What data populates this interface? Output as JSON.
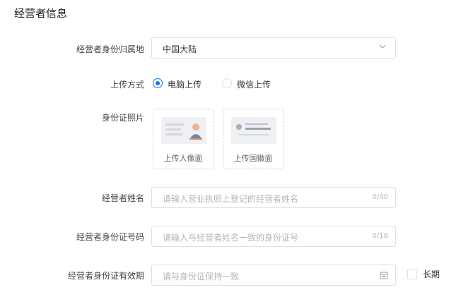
{
  "section": {
    "title": "经营者信息"
  },
  "identity_region": {
    "label": "经营者身份归属地",
    "value": "中国大陆"
  },
  "upload_method": {
    "label": "上传方式",
    "options": [
      {
        "label": "电脑上传",
        "checked": true
      },
      {
        "label": "微信上传",
        "checked": false
      }
    ]
  },
  "id_photos": {
    "label": "身份证照片",
    "portrait_label": "上传人像面",
    "emblem_label": "上传国徽面"
  },
  "operator_name": {
    "label": "经营者姓名",
    "placeholder": "请输入营业执照上登记的经营者姓名",
    "counter": "0/40"
  },
  "operator_id_number": {
    "label": "经营者身份证号码",
    "placeholder": "请输入与经营者姓名一致的身份证号",
    "counter": "0/18"
  },
  "operator_id_validity": {
    "label": "经营者身份证有效期",
    "placeholder": "请与身份证保持一致",
    "long_term_label": "长期"
  },
  "colors": {
    "accent": "#1f6fe8",
    "border": "#dcdfe6",
    "placeholder": "#b6b6b6"
  }
}
